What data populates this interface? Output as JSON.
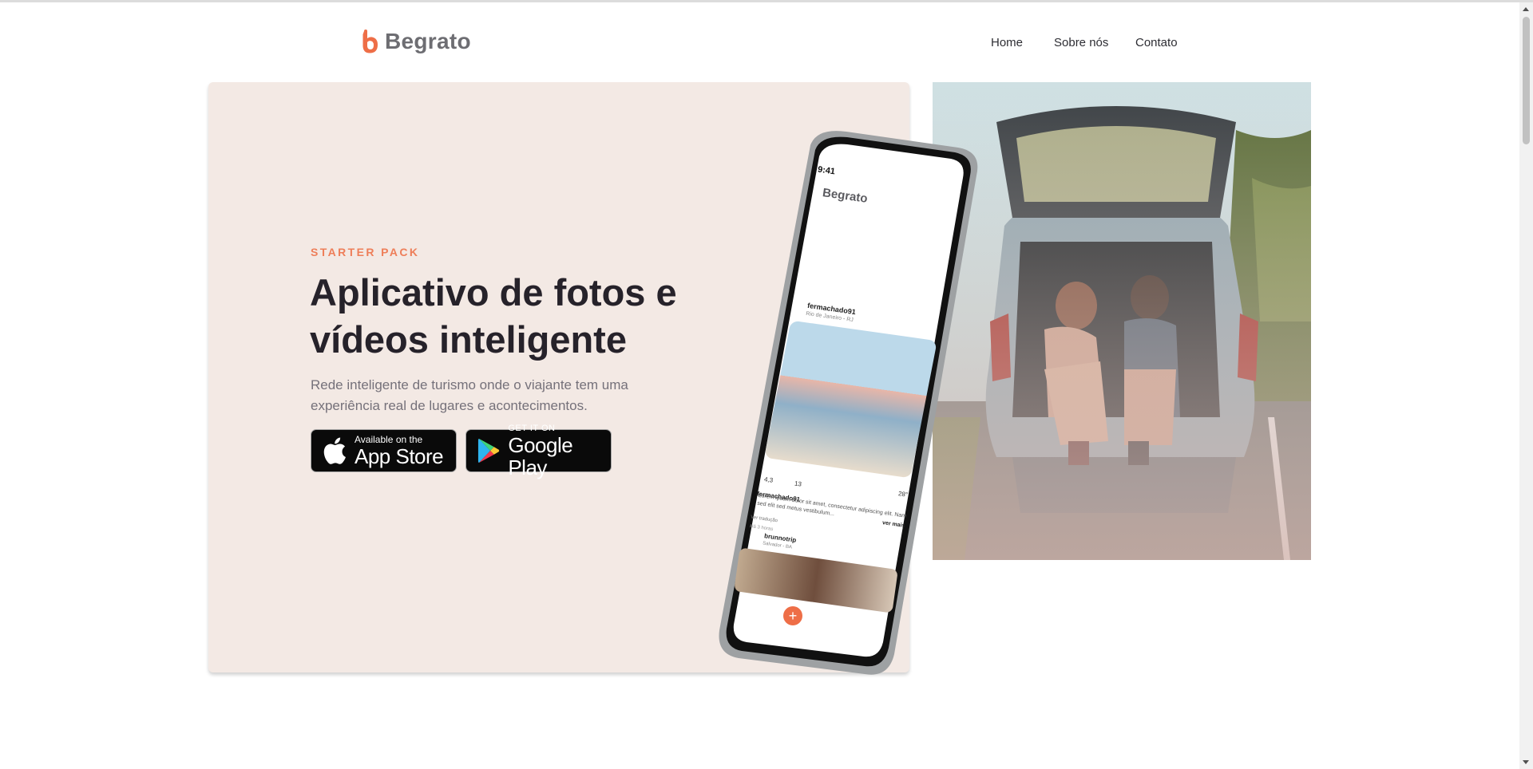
{
  "brand": {
    "name": "Begrato",
    "color": "#ee6e47"
  },
  "nav": {
    "items": [
      "Home",
      "Sobre nós",
      "Contato"
    ]
  },
  "hero": {
    "eyebrow": "STARTER PACK",
    "title": "Aplicativo de fotos e vídeos inteligente",
    "description": "Rede inteligente de turismo onde o viajante tem uma experiência real de lugares e acontecimentos.",
    "appstore": {
      "small": "Available on the",
      "big": "App Store",
      "icon": "apple-icon"
    },
    "googleplay": {
      "small": "GET IT ON",
      "big": "Google Play",
      "icon": "google-play-icon"
    }
  },
  "phone": {
    "time": "9:41",
    "app_name": "Begrato",
    "post1": {
      "user": "fermachado91",
      "location": "Rio de Janeiro - RJ",
      "rating": "4,3",
      "comments": "13",
      "temperature": "28°",
      "caption_user": "fermachado91",
      "caption": "Lorem ipsum dolor sit amet, consectetur adipiscing elit. Nam sed elit sed metus vestibulum...",
      "more": "ver mais",
      "translate": "Ver tradução",
      "time_ago": "Há 3 horas"
    },
    "post2": {
      "user": "brunnotrip",
      "location": "Salvador - BA"
    }
  },
  "colors": {
    "accent": "#ee7e59",
    "card_bg": "#f3e9e4",
    "title": "#26222a"
  }
}
